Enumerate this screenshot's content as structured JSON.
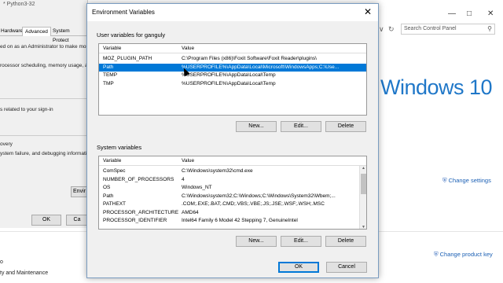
{
  "sysprops": {
    "title_fragment": "* Python3-32",
    "tabs": [
      "Hardware",
      "Advanced",
      "System Protect"
    ],
    "lines": [
      "ed on as an Administrator to make mos",
      "rocessor scheduling, memory usage, an",
      "s related to your sign-in",
      "overy",
      "ystem failure, and debugging informati"
    ],
    "env_button": "Envir",
    "ok": "OK",
    "cancel": "Ca"
  },
  "control_panel": {
    "search_placeholder": "Search Control Panel",
    "brand": "Windows 10",
    "change_settings": "Change settings",
    "change_product_key": "Change product key",
    "bottom_lines": [
      "o",
      "ty and Maintenance"
    ]
  },
  "dialog": {
    "title": "Environment Variables",
    "user_group_label": "User variables for ganguly",
    "system_group_label": "System variables",
    "col_variable": "Variable",
    "col_value": "Value",
    "user_vars": [
      {
        "variable": "MOZ_PLUGIN_PATH",
        "value": "C:\\Program Files (x86)\\Foxit Software\\Foxit Reader\\plugins\\"
      },
      {
        "variable": "Path",
        "value": "%USERPROFILE%\\AppData\\Local\\Microsoft\\WindowsApps;C:\\Use..."
      },
      {
        "variable": "TEMP",
        "value": "%USERPROFILE%\\AppData\\Local\\Temp"
      },
      {
        "variable": "TMP",
        "value": "%USERPROFILE%\\AppData\\Local\\Temp"
      }
    ],
    "user_selected_index": 1,
    "system_vars": [
      {
        "variable": "ComSpec",
        "value": "C:\\Windows\\system32\\cmd.exe"
      },
      {
        "variable": "NUMBER_OF_PROCESSORS",
        "value": "4"
      },
      {
        "variable": "OS",
        "value": "Windows_NT"
      },
      {
        "variable": "Path",
        "value": "C:\\Windows\\system32;C:\\Windows;C:\\Windows\\System32\\Wbem;..."
      },
      {
        "variable": "PATHEXT",
        "value": ".COM;.EXE;.BAT;.CMD;.VBS;.VBE;.JS;.JSE;.WSF;.WSH;.MSC"
      },
      {
        "variable": "PROCESSOR_ARCHITECTURE",
        "value": "AMD64"
      },
      {
        "variable": "PROCESSOR_IDENTIFIER",
        "value": "Intel64 Family 6 Model 42 Stepping 7, GenuineIntel"
      }
    ],
    "new_label": "New...",
    "edit_label": "Edit...",
    "delete_label": "Delete",
    "ok_label": "OK",
    "cancel_label": "Cancel"
  },
  "colors": {
    "selection": "#0078d7",
    "brand_blue": "#1f77c8",
    "link": "#1a5fb4"
  }
}
